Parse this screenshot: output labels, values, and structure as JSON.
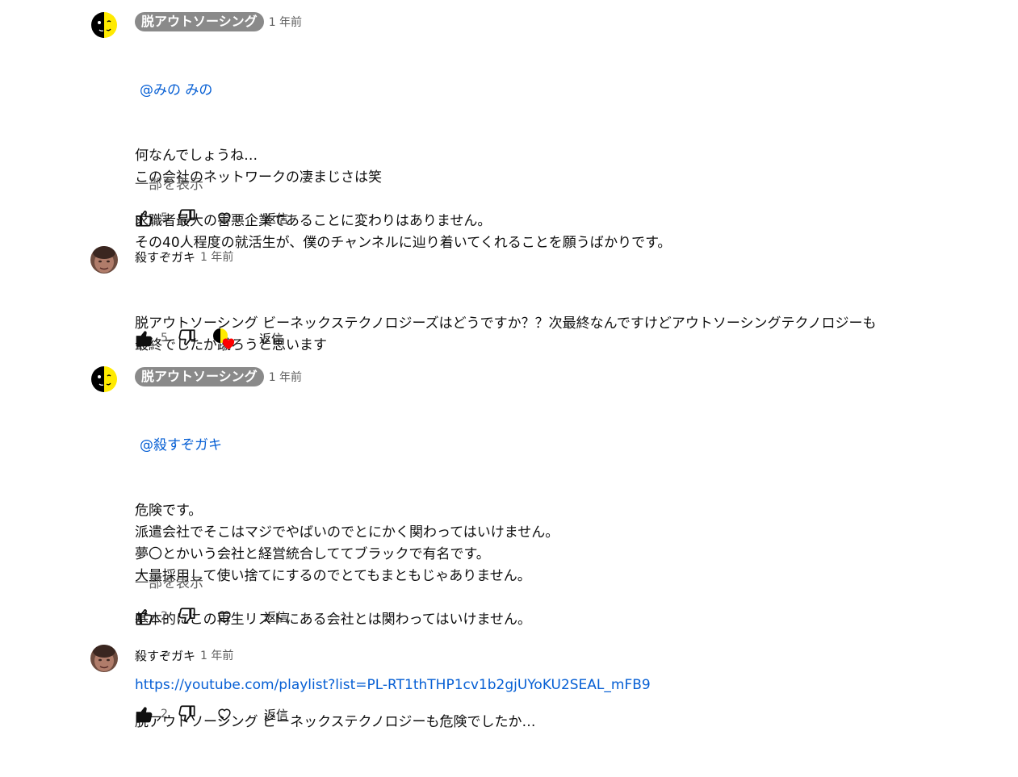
{
  "comments": [
    {
      "author": "脱アウトソーシング",
      "time": "1 年前",
      "mention": "@みの みの",
      "lines": "何なんでしょうね…\nこの会社のネットワークの凄まじさは笑\n\n求職者最大の害悪企業であることに変わりはありません。\nその40人程度の就活生が、僕のチャンネルに辿り着いてくれることを願うばかりです。",
      "more": "一部を表示",
      "likes": "5",
      "reply": "返信"
    },
    {
      "author": "殺すぞガキ",
      "time": "1 年前",
      "lines": "脱アウトソーシング ビーネックステクノロジーズはどうですか？？次最終なんですけどアウトソーシングテクノロジーも\n最終でしたが蹴ろうと思います",
      "likes": "5",
      "reply": "返信"
    },
    {
      "author": "脱アウトソーシング",
      "time": "1 年前",
      "mention": "@殺すぞガキ",
      "lines": "危険です。\n派遣会社でそこはマジでやばいのでとにかく関わってはいけません。\n夢〇とかいう会社と経営統合しててブラックで有名です。\n大量採用して使い捨てにするのでとてもまともじゃありません。\n\n基本的にこの再生リストにある会社とは関わってはいけません。",
      "link": "https://youtube.com/playlist?list=PL-RT1thTHP1cv1b2gjUYoKU2SEAL_mFB9",
      "more": "一部を表示",
      "likes": "2",
      "reply": "返信"
    },
    {
      "author": "殺すぞガキ",
      "time": "1 年前",
      "lines": "脱アウトソーシング ビーネックステクノロジーも危険でしたか…",
      "likes": "2",
      "reply": "返信"
    }
  ],
  "colors": {
    "link": "#065fd4",
    "chip": "#8a8a8a",
    "heart": "#ff0000"
  },
  "icons": [
    "like-icon",
    "dislike-icon",
    "heart-icon",
    "creator-heart-icon"
  ]
}
